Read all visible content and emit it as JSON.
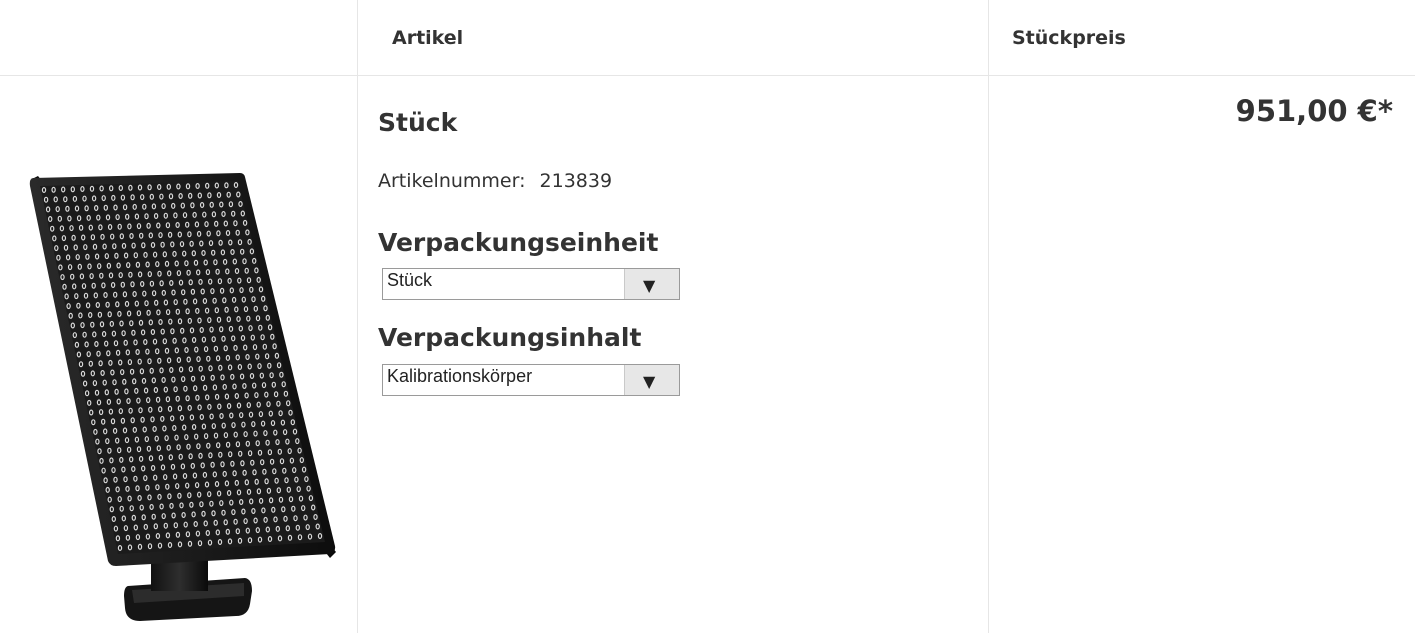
{
  "header": {
    "col_article": "Artikel",
    "col_unit_price": "Stückpreis"
  },
  "product": {
    "title": "Stück",
    "article_number_label": "Artikelnummer:",
    "article_number": "213839",
    "image_icon": "calibration-board-image"
  },
  "packaging_unit": {
    "label": "Verpackungseinheit",
    "selected": "Stück"
  },
  "packaging_content": {
    "label": "Verpackungsinhalt",
    "selected": "Kalibrationskörper"
  },
  "price": {
    "value": "951,00 €*"
  },
  "colors": {
    "text": "#333333",
    "border": "#e6e6e6",
    "board": "#1a1a1a"
  }
}
